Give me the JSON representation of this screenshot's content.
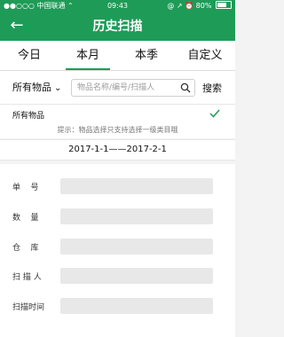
{
  "status_bar": {
    "carrier": "●●○○○ 中国联通 ⌃",
    "time": "09:43",
    "right": "@ ↗ ⏰ 80%"
  },
  "nav": {
    "title": "历史扫描",
    "back_icon": "arrow-left-icon"
  },
  "tabs": [
    {
      "label": "今日",
      "active": false
    },
    {
      "label": "本月",
      "active": true
    },
    {
      "label": "本季",
      "active": false
    },
    {
      "label": "自定义",
      "active": false
    }
  ],
  "filter": {
    "category": "所有物品",
    "search_placeholder": "物品名称/编号/扫描人",
    "search_button": "搜索"
  },
  "selected": {
    "label": "所有物品",
    "hint": "提示：物品选择只支持选择一级类目哦"
  },
  "date_range": "2017-1-1——2017-2-1",
  "form": {
    "fields": [
      {
        "label": "单    号",
        "value": ""
      },
      {
        "label": "数    量",
        "value": ""
      },
      {
        "label": "仓    库",
        "value": ""
      },
      {
        "label": "扫 描 人",
        "value": ""
      },
      {
        "label": "扫描时间",
        "value": ""
      }
    ]
  },
  "colors": {
    "primary": "#1e9b57",
    "field_bg": "#e8e8e8"
  }
}
